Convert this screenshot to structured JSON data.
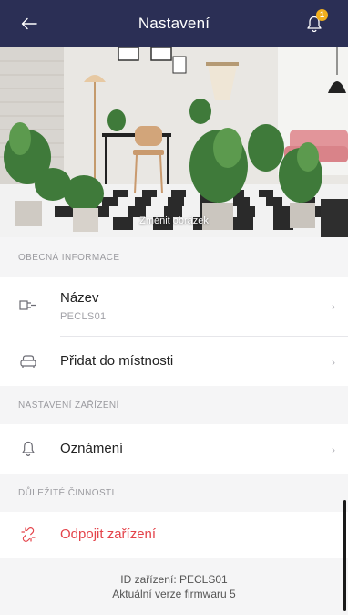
{
  "header": {
    "title": "Nastavení",
    "notification_count": "1"
  },
  "photo": {
    "change_label": "Změnit obrázek"
  },
  "sections": {
    "general": {
      "title": "OBECNÁ INFORMACE",
      "name_label": "Název",
      "name_value": "PECLS01",
      "add_room_label": "Přidat do místnosti"
    },
    "device_settings": {
      "title": "NASTAVENÍ ZAŘÍZENÍ",
      "notifications_label": "Oznámení"
    },
    "important": {
      "title": "DŮLEŽITÉ ČINNOSTI",
      "disconnect_label": "Odpojit zařízení"
    }
  },
  "footer": {
    "device_id": "ID zařízení: PECLS01",
    "firmware": "Aktuální verze firmwaru 5"
  },
  "colors": {
    "header_bg": "#2b2f55",
    "danger": "#e4434a",
    "badge": "#f2b01e"
  }
}
